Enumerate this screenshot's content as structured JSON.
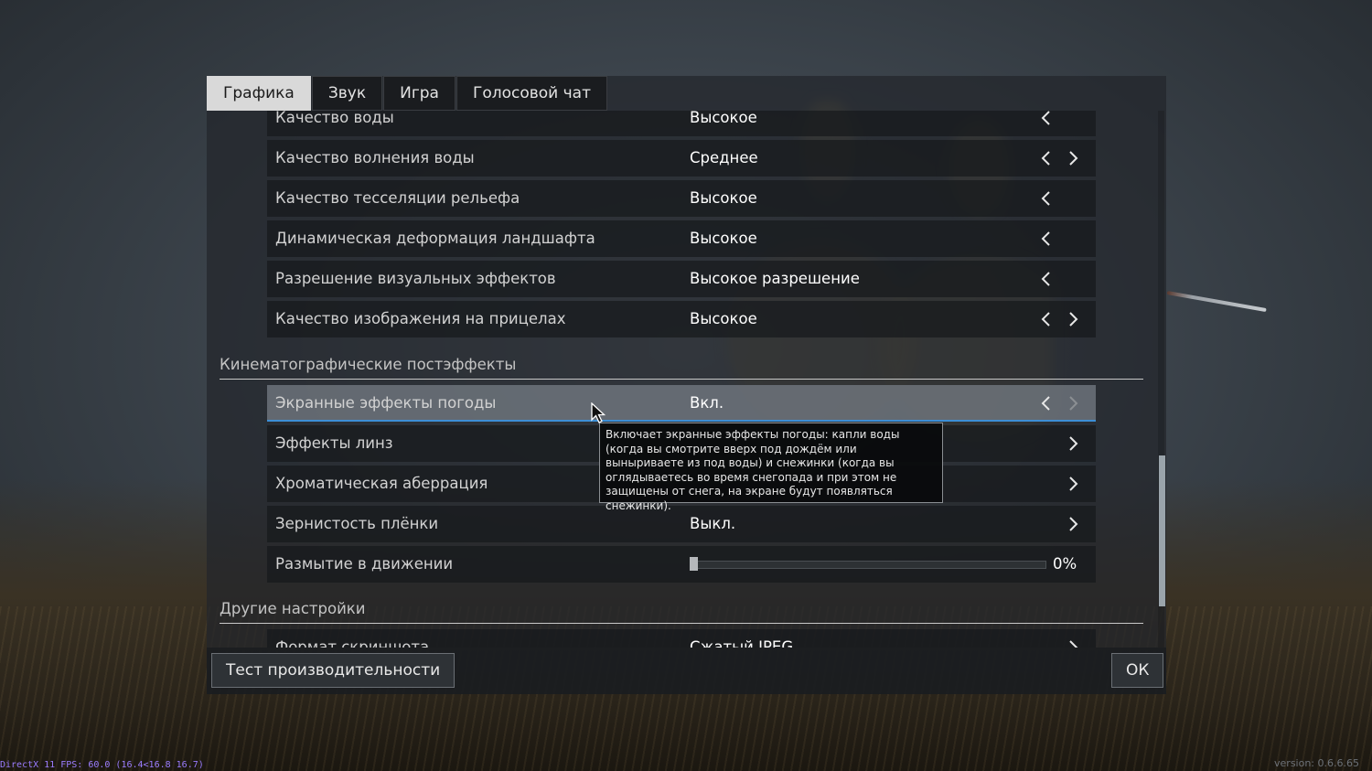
{
  "tabs": [
    {
      "label": "Графика",
      "active": true
    },
    {
      "label": "Звук",
      "active": false
    },
    {
      "label": "Игра",
      "active": false
    },
    {
      "label": "Голосовой чат",
      "active": false
    }
  ],
  "rows_top": [
    {
      "label": "Качество воды",
      "value": "Высокое",
      "left": true,
      "right": false
    },
    {
      "label": "Качество волнения воды",
      "value": "Среднее",
      "left": true,
      "right": true
    },
    {
      "label": "Качество тесселяции рельефа",
      "value": "Высокое",
      "left": true,
      "right": false
    },
    {
      "label": "Динамическая деформация ландшафта",
      "value": "Высокое",
      "left": true,
      "right": false
    },
    {
      "label": "Разрешение визуальных эффектов",
      "value": "Высокое разрешение",
      "left": true,
      "right": false
    },
    {
      "label": "Качество изображения на прицелах",
      "value": "Высокое",
      "left": true,
      "right": true
    }
  ],
  "section_cinematic": "Кинематографические постэффекты",
  "rows_cinematic": [
    {
      "label": "Экранные эффекты погоды",
      "value": "Вкл."
    },
    {
      "label": "Эффекты линз",
      "value": ""
    },
    {
      "label": "Хроматическая аберрация",
      "value": ""
    },
    {
      "label": "Зернистость плёнки",
      "value": "Выкл."
    },
    {
      "label": "Размытие в движении",
      "value": "0%",
      "slider_fraction": 0.0
    }
  ],
  "section_other": "Другие настройки",
  "row_partial": {
    "label": "Формат скриншота",
    "value": "Сжатый JPEG"
  },
  "tooltip": "Включает экранные эффекты погоды: капли воды (когда вы смотрите вверх под дождём или выныриваете из под воды) и снежинки (когда вы оглядываетесь во время снегопада и при этом не защищены от снега, на экране будут появляться снежинки).",
  "footer": {
    "benchmark": "Тест производительности",
    "ok": "ОК"
  },
  "overlay": {
    "fps": "DirectX 11 FPS: 60.0 (16.4<16.8 16.7)",
    "version": "version: 0.6.6.65"
  },
  "colors": {
    "highlight_border": "#3d8fd6",
    "fps_text": "#9b7dff"
  }
}
